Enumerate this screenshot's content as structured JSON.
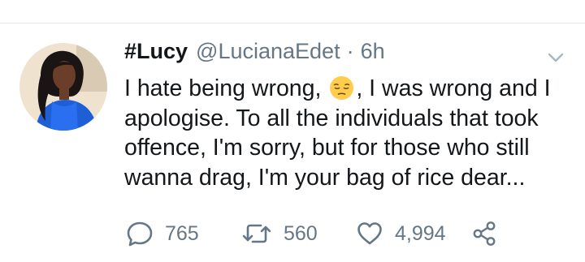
{
  "tweet": {
    "display_name": "#Lucy",
    "handle": "@LucianaEdet",
    "separator": "·",
    "time": "6h",
    "text_part1": "I hate being wrong, ",
    "emoji": "pensive-face",
    "text_part2": ", I was wrong and I apologise. To all the individuals that took offence, I'm sorry, but for those who still wanna drag, I'm your bag of rice dear..."
  },
  "actions": {
    "replies": "765",
    "retweets": "560",
    "likes": "4,994"
  },
  "icons": {
    "reply": "speech-bubble-icon",
    "retweet": "retweet-icon",
    "like": "heart-icon",
    "share": "share-icon",
    "menu": "chevron-down-icon"
  },
  "colors": {
    "text": "#14171a",
    "secondary": "#657786",
    "divider": "#e1e8ed",
    "emoji": "#ffcc4d"
  }
}
